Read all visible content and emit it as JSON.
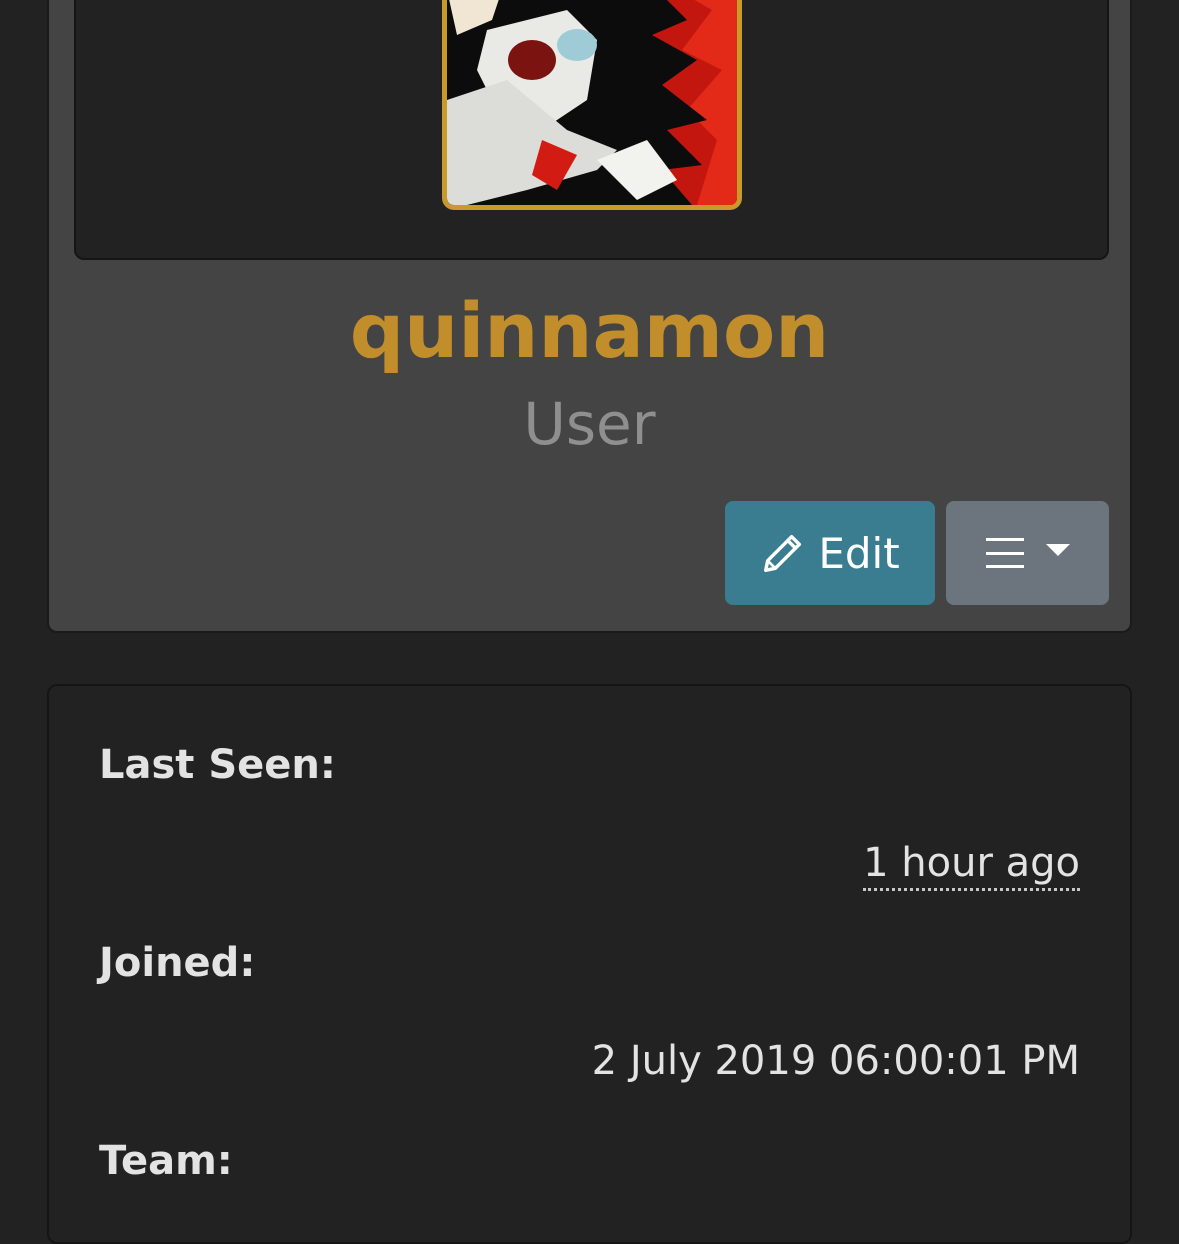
{
  "profile": {
    "username": "quinnamon",
    "role": "User",
    "accent_color": "#c18e2b",
    "avatar_icon": "avatar-image"
  },
  "actions": {
    "edit_label": "Edit",
    "edit_icon": "pencil-icon",
    "menu_icon": "hamburger-icon",
    "menu_caret_icon": "caret-down-icon",
    "edit_color": "#3a7d91",
    "menu_color": "#6c757d"
  },
  "info": {
    "last_seen_label": "Last Seen:",
    "last_seen_value": "1 hour ago",
    "joined_label": "Joined:",
    "joined_value": "2 July 2019 06:00:01 PM",
    "team_label": "Team:"
  }
}
